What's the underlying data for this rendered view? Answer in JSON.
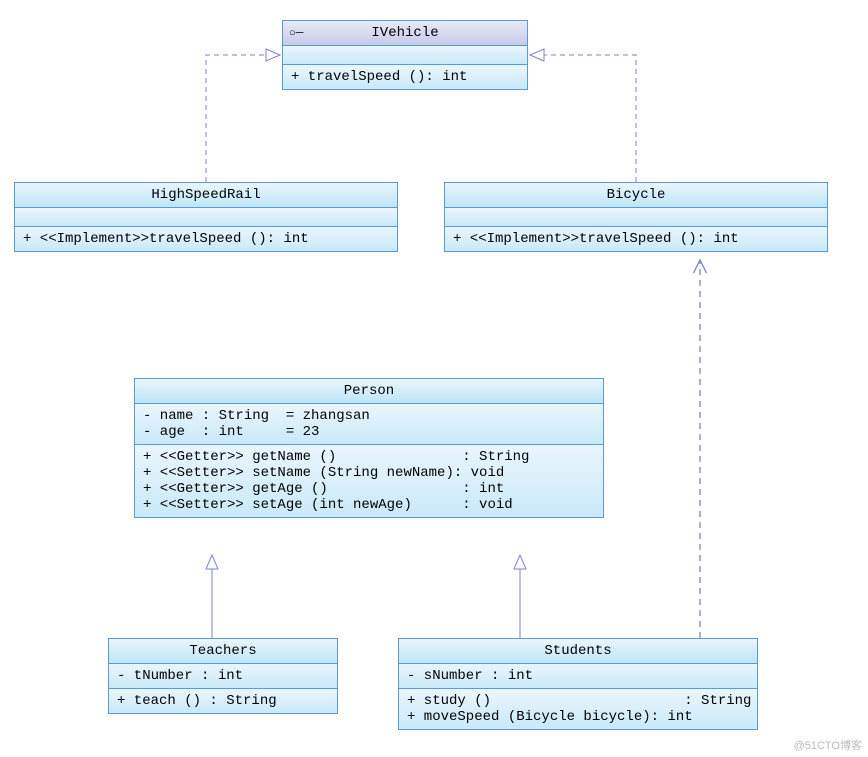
{
  "diagram": {
    "interface": {
      "name": "IVehicle",
      "operations": [
        "+ travelSpeed (): int"
      ]
    },
    "classes": {
      "highSpeedRail": {
        "name": "HighSpeedRail",
        "operations": [
          "+ <<Implement>>travelSpeed (): int"
        ]
      },
      "bicycle": {
        "name": "Bicycle",
        "operations": [
          "+ <<Implement>>travelSpeed (): int"
        ]
      },
      "person": {
        "name": "Person",
        "attributes": [
          "- name : String  = zhangsan",
          "- age  : int     = 23"
        ],
        "operations": [
          "+ <<Getter>> getName ()               : String",
          "+ <<Setter>> setName (String newName): void",
          "+ <<Getter>> getAge ()                : int",
          "+ <<Setter>> setAge (int newAge)      : void"
        ]
      },
      "teachers": {
        "name": "Teachers",
        "attributes": [
          "- tNumber : int"
        ],
        "operations": [
          "+ teach () : String"
        ]
      },
      "students": {
        "name": "Students",
        "attributes": [
          "- sNumber : int"
        ],
        "operations": [
          "+ study ()                       : String",
          "+ moveSpeed (Bicycle bicycle): int"
        ]
      }
    },
    "relationships": [
      {
        "from": "HighSpeedRail",
        "to": "IVehicle",
        "type": "realization"
      },
      {
        "from": "Bicycle",
        "to": "IVehicle",
        "type": "realization"
      },
      {
        "from": "Teachers",
        "to": "Person",
        "type": "generalization"
      },
      {
        "from": "Students",
        "to": "Person",
        "type": "generalization"
      },
      {
        "from": "Students",
        "to": "Bicycle",
        "type": "dependency"
      }
    ]
  },
  "watermark": "@51CTO博客"
}
